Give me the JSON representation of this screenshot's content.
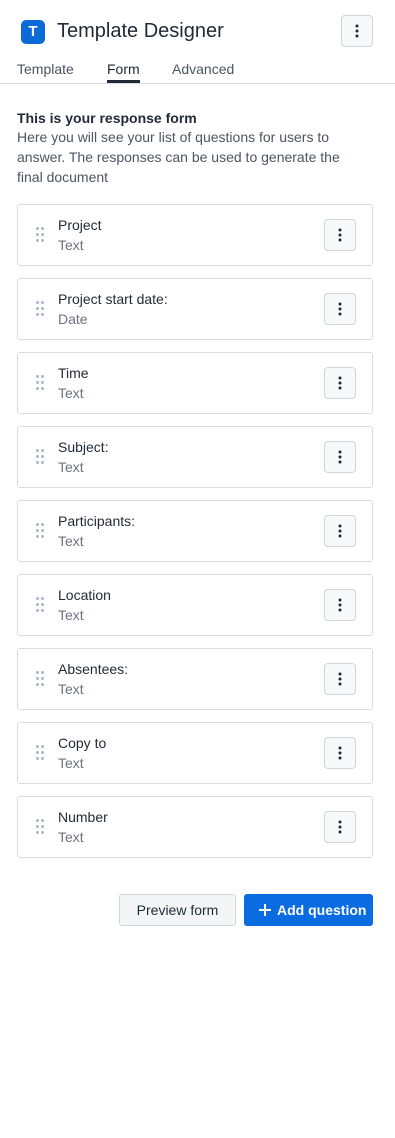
{
  "app": {
    "logo_letter": "T",
    "title": "Template Designer",
    "accent_color": "#0b6bd6"
  },
  "tabs": [
    {
      "label": "Template",
      "active": false
    },
    {
      "label": "Form",
      "active": true
    },
    {
      "label": "Advanced",
      "active": false
    }
  ],
  "intro": {
    "heading": "This is your response form",
    "text": "Here you will see your list of questions for users to answer. The responses can be used to generate the final document"
  },
  "questions": [
    {
      "label": "Project",
      "type": "Text"
    },
    {
      "label": "Project start date:",
      "type": "Date"
    },
    {
      "label": "Time",
      "type": "Text"
    },
    {
      "label": "Subject:",
      "type": "Text"
    },
    {
      "label": "Participants:",
      "type": "Text"
    },
    {
      "label": "Location",
      "type": "Text"
    },
    {
      "label": "Absentees:",
      "type": "Text"
    },
    {
      "label": "Copy to",
      "type": "Text"
    },
    {
      "label": "Number",
      "type": "Text"
    }
  ],
  "footer": {
    "preview_label": "Preview form",
    "add_label": "Add question"
  },
  "icons": {
    "header_menu": "kebab-menu-icon",
    "question_menu": "kebab-menu-icon",
    "drag": "drag-handle-icon",
    "add": "plus-icon"
  }
}
